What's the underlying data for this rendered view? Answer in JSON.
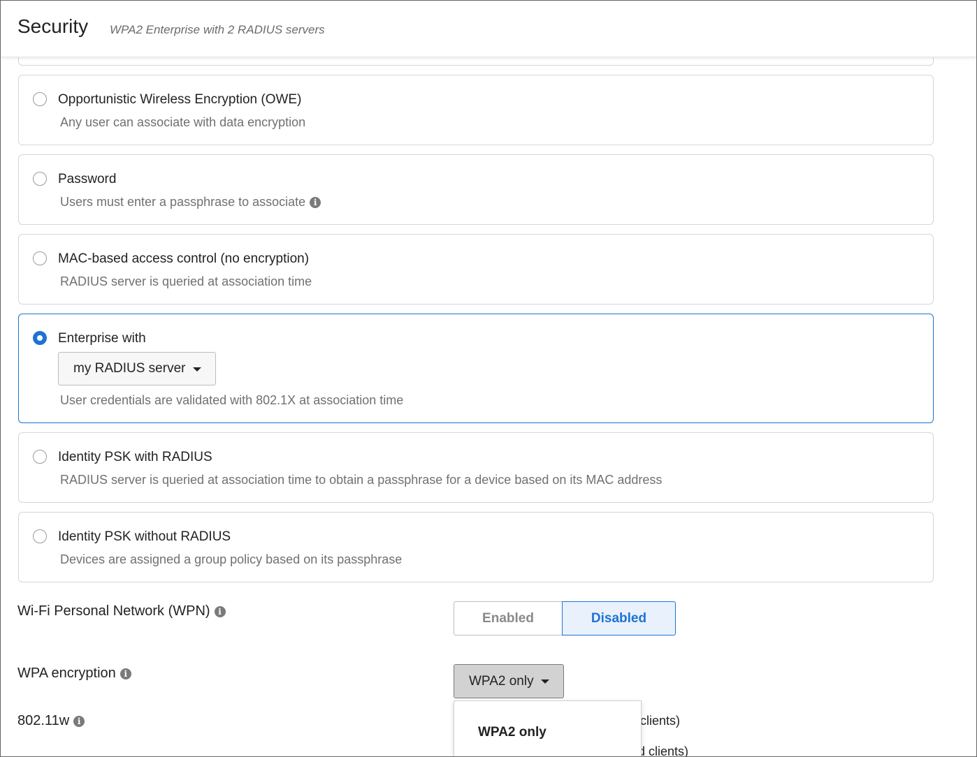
{
  "header": {
    "title": "Security",
    "subtitle": "WPA2 Enterprise with 2 RADIUS servers"
  },
  "options": [
    {
      "title": "Opportunistic Wireless Encryption (OWE)",
      "description": "Any user can associate with data encryption",
      "selected": false
    },
    {
      "title": "Password",
      "description": "Users must enter a passphrase to associate",
      "selected": false,
      "info_icon": "info-icon"
    },
    {
      "title": "MAC-based access control (no encryption)",
      "description": "RADIUS server is queried at association time",
      "selected": false
    },
    {
      "title": "Enterprise with",
      "dropdown_value": "my RADIUS server",
      "description": "User credentials are validated with 802.1X at association time",
      "selected": true
    },
    {
      "title": "Identity PSK with RADIUS",
      "description": "RADIUS server is queried at association time to obtain a passphrase for a device based on its MAC address",
      "selected": false
    },
    {
      "title": "Identity PSK without RADIUS",
      "description": "Devices are assigned a group policy based on its passphrase",
      "selected": false
    }
  ],
  "wpn": {
    "label": "Wi-Fi Personal Network (WPN)",
    "enabled_label": "Enabled",
    "disabled_label": "Disabled",
    "selected": "Disabled"
  },
  "wpa_encryption": {
    "label": "WPA encryption",
    "value": "WPA2 only",
    "menu_items": [
      "WPA2 only"
    ]
  },
  "dot11w": {
    "label": "802.11w",
    "partial_text_1": "clients)",
    "partial_text_2": "d clients)"
  },
  "colors": {
    "accent": "#1e73d2",
    "selected_bg": "#e8f1fc"
  }
}
